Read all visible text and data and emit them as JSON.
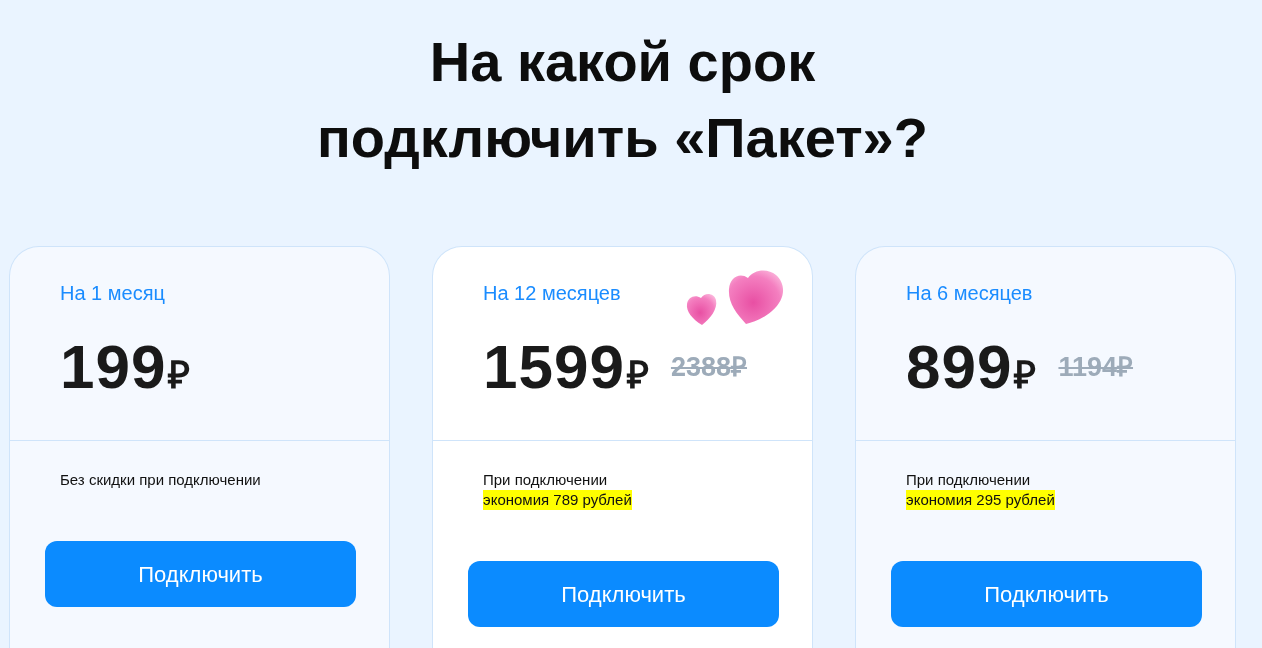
{
  "title": "На какой срок подключить «Пакет»?",
  "plans": [
    {
      "period": "На 1 месяц",
      "price": "199",
      "currency": "₽",
      "featured": false,
      "note_lines": [
        {
          "text": "Без скидки при подключении",
          "highlighted": false
        }
      ],
      "button": "Подключить"
    },
    {
      "period": "На 12 месяцев",
      "price": "1599",
      "currency": "₽",
      "old_price": "2388₽",
      "featured": true,
      "note_lines": [
        {
          "text": "При подключении",
          "highlighted": false
        },
        {
          "text": "экономия 789 рублей",
          "highlighted": true
        }
      ],
      "button": "Подключить"
    },
    {
      "period": "На 6 месяцев",
      "price": "899",
      "currency": "₽",
      "old_price": "1194₽",
      "featured": false,
      "note_lines": [
        {
          "text": "При подключении",
          "highlighted": false
        },
        {
          "text": "экономия 295 рублей",
          "highlighted": true
        }
      ],
      "button": "Подключить"
    }
  ]
}
